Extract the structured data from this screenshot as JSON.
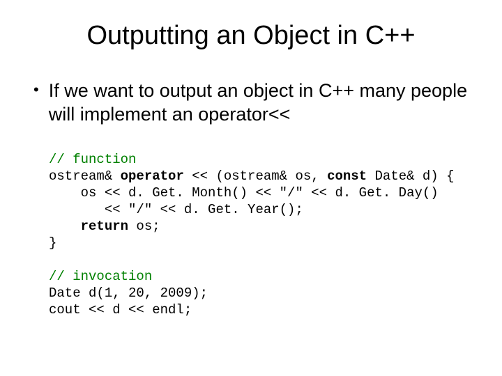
{
  "title": "Outputting an Object in C++",
  "bullet": "If we want to output an object in C++ many people will implement an operator<<",
  "code": {
    "c1": "// function",
    "l2a": "ostream& ",
    "l2b": "operator",
    "l2c": " << (ostream& os, ",
    "l2d": "const",
    "l2e": " Date& d) {",
    "l3": "    os << d. Get. Month() << \"/\" << d. Get. Day()",
    "l4": "       << \"/\" << d. Get. Year();",
    "l5a": "    ",
    "l5b": "return",
    "l5c": " os;",
    "l6": "}",
    "c2": "// invocation",
    "l8": "Date d(1, 20, 2009);",
    "l9": "cout << d << endl;"
  }
}
